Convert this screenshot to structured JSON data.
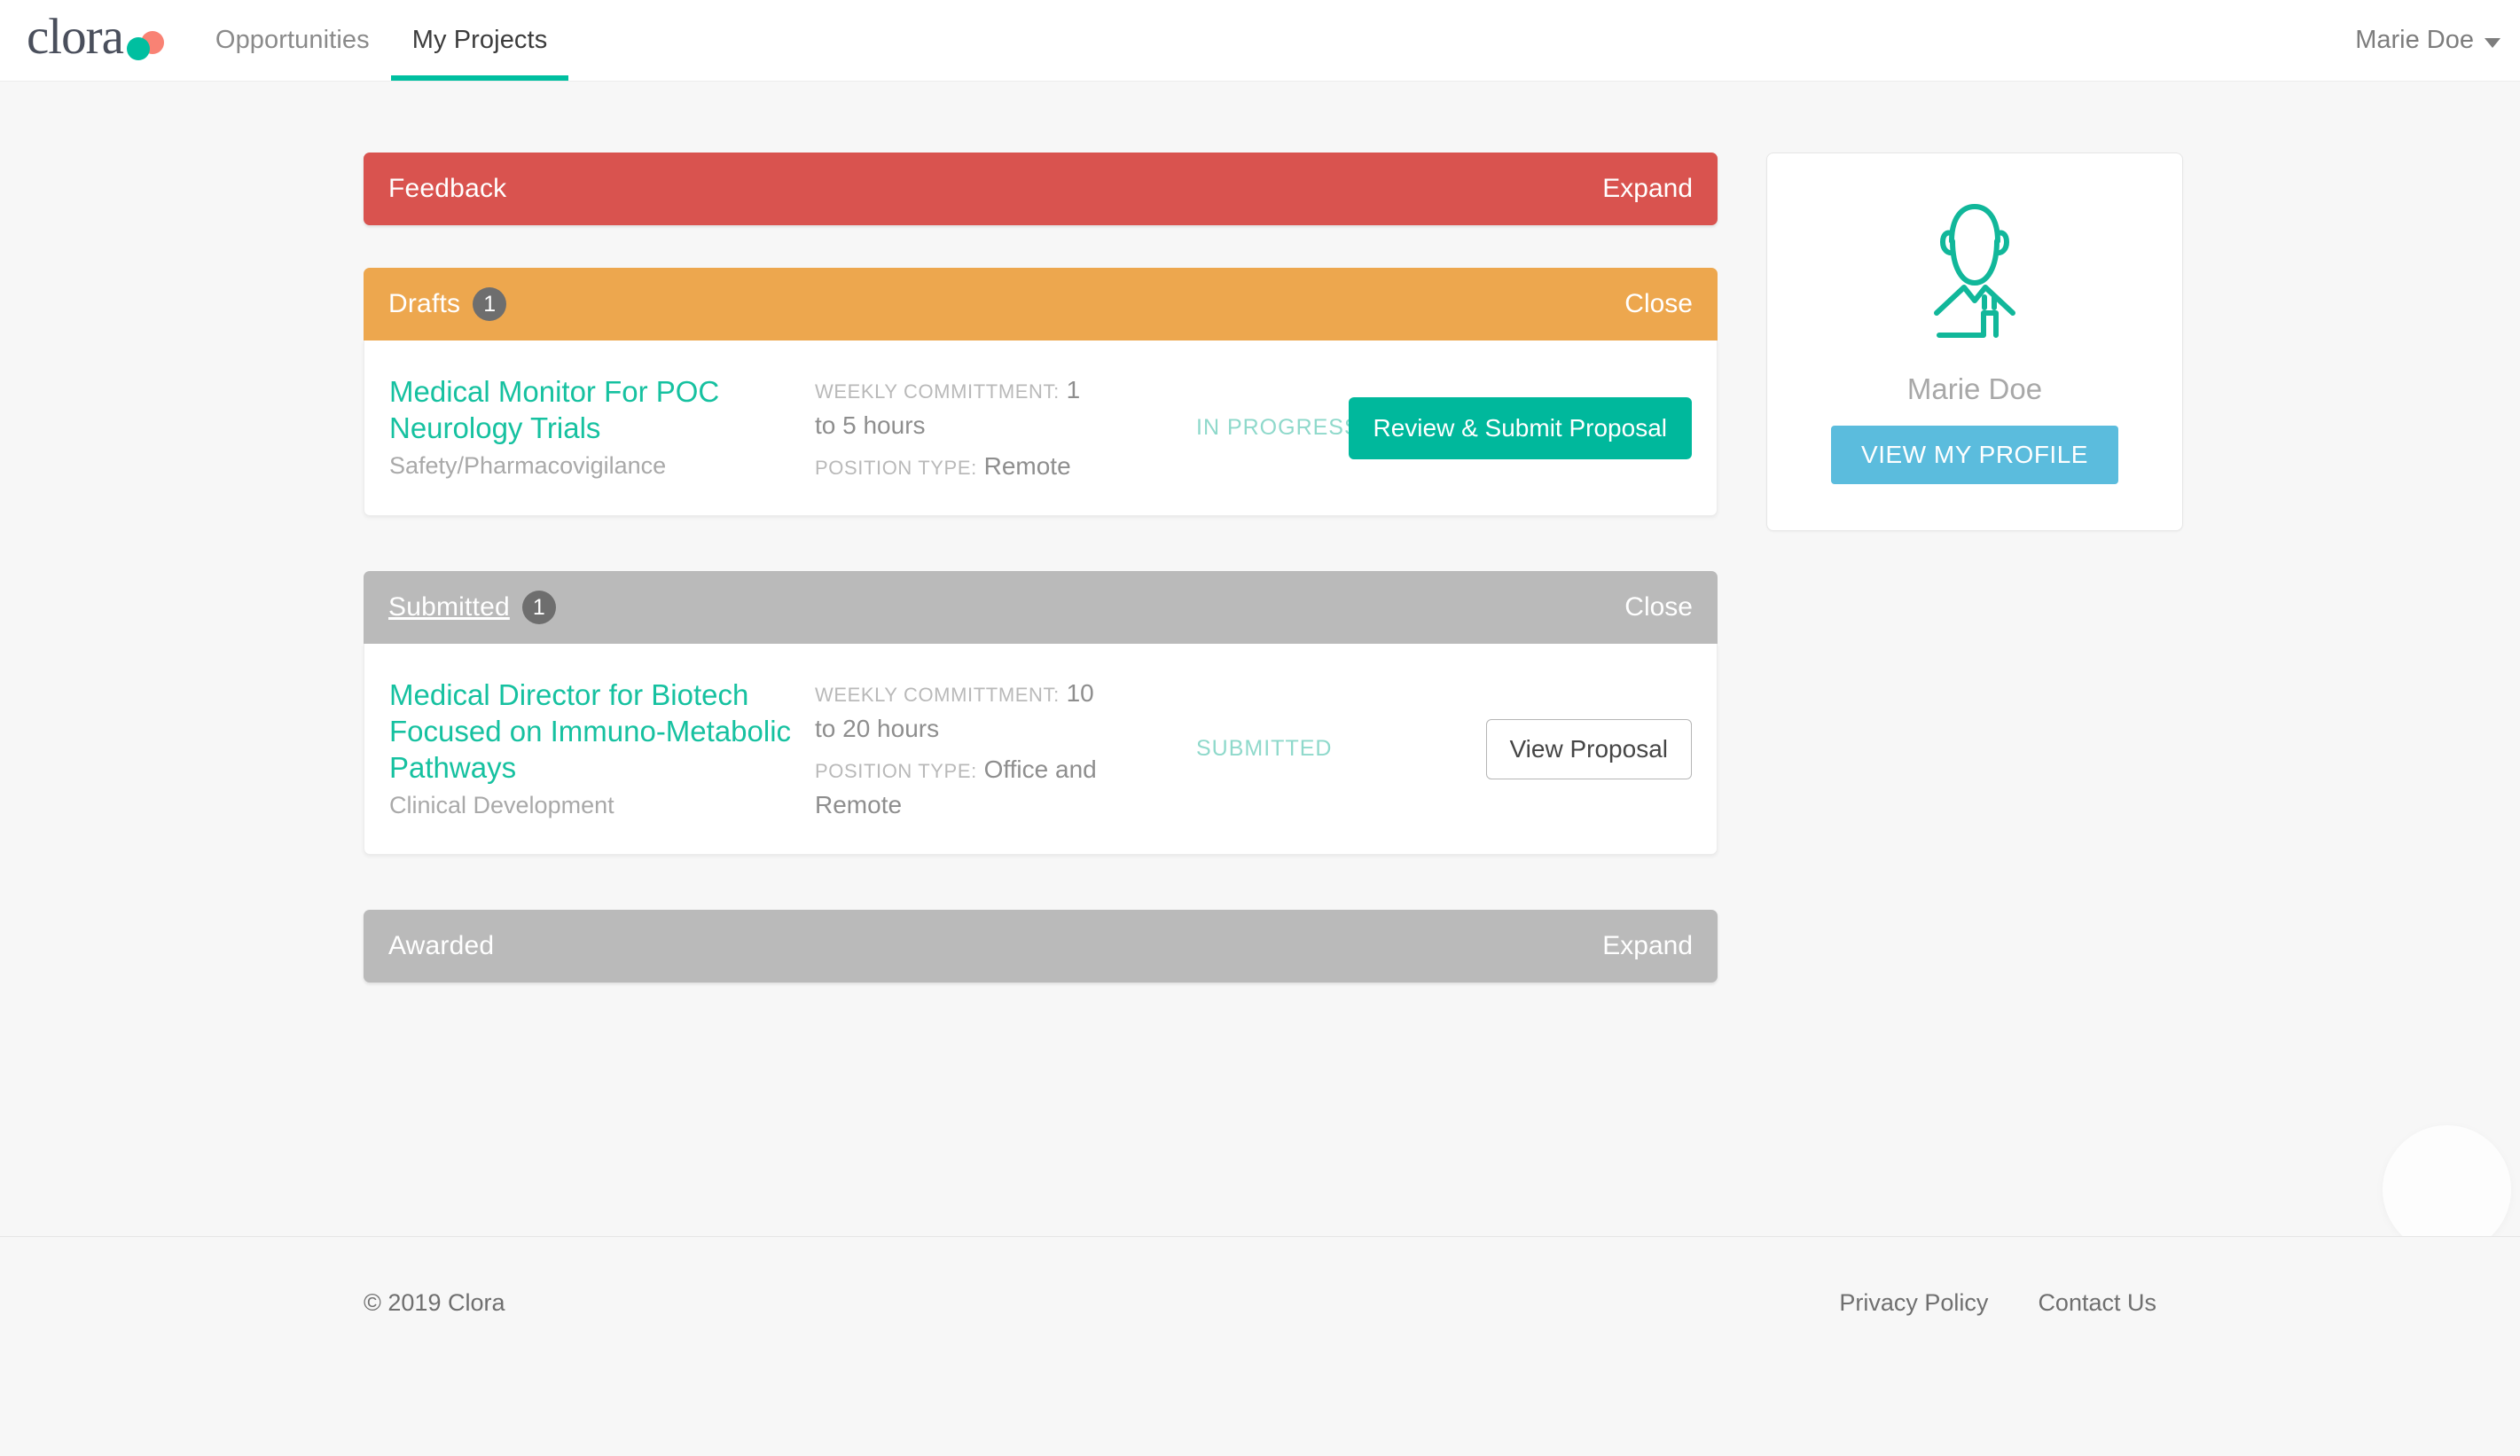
{
  "header": {
    "brand": "clora",
    "brand_icon": "clora-logo-dots",
    "tabs": [
      {
        "label": "Opportunities",
        "active": false
      },
      {
        "label": "My Projects",
        "active": true
      }
    ],
    "user_menu": {
      "label": "Marie Doe",
      "caret_icon": "chevron-down-icon"
    }
  },
  "sections": {
    "feedback": {
      "title": "Feedback",
      "action": "Expand",
      "color": "#d9534f",
      "expanded": false
    },
    "drafts": {
      "title": "Drafts",
      "count": "1",
      "action": "Close",
      "color": "#eda74e",
      "expanded": true,
      "project": {
        "title": "Medical Monitor For POC Neurology Trials",
        "category": "Safety/Pharmacovigilance",
        "weekly_commitment_label": "WEEKLY COMMITTMENT:",
        "weekly_commitment_value": "1 to 5 hours",
        "position_type_label": "POSITION TYPE:",
        "position_type_value": "Remote",
        "status": "IN PROGRESS",
        "action_label": "Review & Submit Proposal"
      }
    },
    "submitted": {
      "title": "Submitted",
      "count": "1",
      "action": "Close",
      "color": "#bababa",
      "expanded": true,
      "project": {
        "title": "Medical Director for Biotech Focused on Immuno-Metabolic Pathways",
        "category": "Clinical Development",
        "weekly_commitment_label": "WEEKLY COMMITTMENT:",
        "weekly_commitment_value": "10 to 20 hours",
        "position_type_label": "POSITION TYPE:",
        "position_type_value": "Office and Remote",
        "status": "SUBMITTED",
        "action_label": "View Proposal"
      }
    },
    "awarded": {
      "title": "Awarded",
      "action": "Expand",
      "color": "#bababa",
      "expanded": false
    }
  },
  "profile_card": {
    "avatar_icon": "doctor-avatar-icon",
    "name": "Marie Doe",
    "button_label": "VIEW MY PROFILE",
    "button_color": "#5bbcdd"
  },
  "footer": {
    "copyright": "© 2019 Clora",
    "links": [
      {
        "label": "Privacy Policy"
      },
      {
        "label": "Contact Us"
      }
    ]
  },
  "chat_widget": {
    "icon": "chat-bubble-icon"
  },
  "theme": {
    "accent_teal": "#00bfa0",
    "accent_coral": "#f98274",
    "page_bg": "#f7f7f7"
  }
}
